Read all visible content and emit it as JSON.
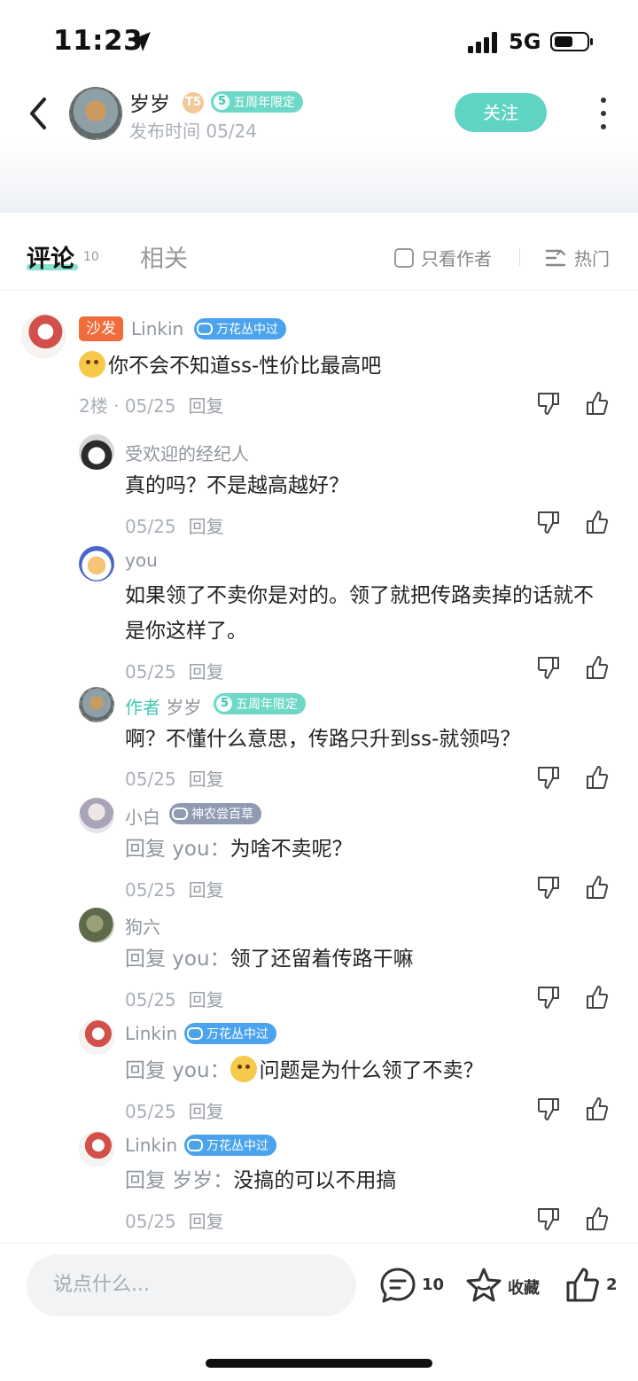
{
  "status": {
    "time": "11:23",
    "network": "5G"
  },
  "header": {
    "author": "岁岁",
    "rank_badge": "T5",
    "tag": "五周年限定",
    "post_time": "发布时间 05/24",
    "follow_label": "关注"
  },
  "tabs": {
    "comments_label": "评论",
    "comments_count": "10",
    "related_label": "相关",
    "only_author_label": "只看作者",
    "sort_label": "热门"
  },
  "main_comment": {
    "sofa": "沙发",
    "user": "Linkin",
    "tag": "万花丛中过",
    "text": "你不会不知道ss-性价比最高吧",
    "floor": "2楼",
    "date": "05/25",
    "reply_label": "回复"
  },
  "replies": [
    {
      "user": "受欢迎的经纪人",
      "text": "真的吗？不是越高越好？",
      "date": "05/25",
      "reply_label": "回复"
    },
    {
      "user": "you",
      "text": "如果领了不卖你是对的。领了就把传路卖掉的话就不是你这样了。",
      "date": "05/25",
      "reply_label": "回复"
    },
    {
      "author_label": "作者",
      "user": "岁岁",
      "tag": "五周年限定",
      "text": "啊？不懂什么意思，传路只升到ss-就领吗？",
      "date": "05/25",
      "reply_label": "回复"
    },
    {
      "user": "小白",
      "tag": "神农尝百草",
      "reply_prefix": "回复 you：",
      "text": "为啥不卖呢？",
      "date": "05/25",
      "reply_label": "回复"
    },
    {
      "user": "狗六",
      "reply_prefix": "回复 you：",
      "text": "领了还留着传路干嘛",
      "date": "05/25",
      "reply_label": "回复"
    },
    {
      "user": "Linkin",
      "tag": "万花丛中过",
      "reply_prefix": "回复 you：",
      "text": "问题是为什么领了不卖？",
      "date": "05/25",
      "reply_label": "回复"
    },
    {
      "user": "Linkin",
      "tag": "万花丛中过",
      "reply_prefix": "回复 岁岁：",
      "text": "没搞的可以不用搞",
      "date": "05/25",
      "reply_label": "回复"
    }
  ],
  "bottom": {
    "input_placeholder": "说点什么...",
    "comment_count": "10",
    "favorite_label": "收藏",
    "like_count": "2"
  },
  "colors": {
    "accent": "#5fd4c3",
    "sofa": "#f06d3b",
    "tag_blue": "#4aa3ec",
    "tag_green": "#6ed8c7"
  }
}
